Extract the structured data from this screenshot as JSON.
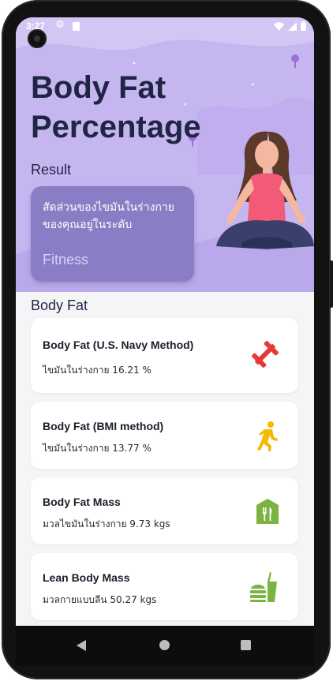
{
  "status_bar": {
    "time": "3:27"
  },
  "header": {
    "title": "Body Fat Percentage"
  },
  "result": {
    "label": "Result",
    "description": "สัดส่วนของไขมันในร่างกายของคุณอยู่ในระดับ",
    "level": "Fitness"
  },
  "section": {
    "title": "Body Fat"
  },
  "cards": [
    {
      "title": "Body Fat (U.S. Navy Method)",
      "value": "ไขมันในร่างกาย 16.21 %",
      "icon": "dumbbell-icon",
      "color": "#e53935"
    },
    {
      "title": "Body Fat (BMI method)",
      "value": "ไขมันในร่างกาย 13.77 %",
      "icon": "running-icon",
      "color": "#f6b800"
    },
    {
      "title": "Body Fat Mass",
      "value": "มวลไขมันในร่างกาย 9.73 kgs",
      "icon": "restaurant-icon",
      "color": "#7cb342"
    },
    {
      "title": "Lean Body Mass",
      "value": "มวลกายแบบลีน 50.27 kgs",
      "icon": "fastfood-icon",
      "color": "#7cb342"
    }
  ],
  "colors": {
    "hero_bg": "#c6b6f0",
    "result_card": "#8a7dc5",
    "title_text": "#202545",
    "screen_bg": "#f5f5f7"
  }
}
